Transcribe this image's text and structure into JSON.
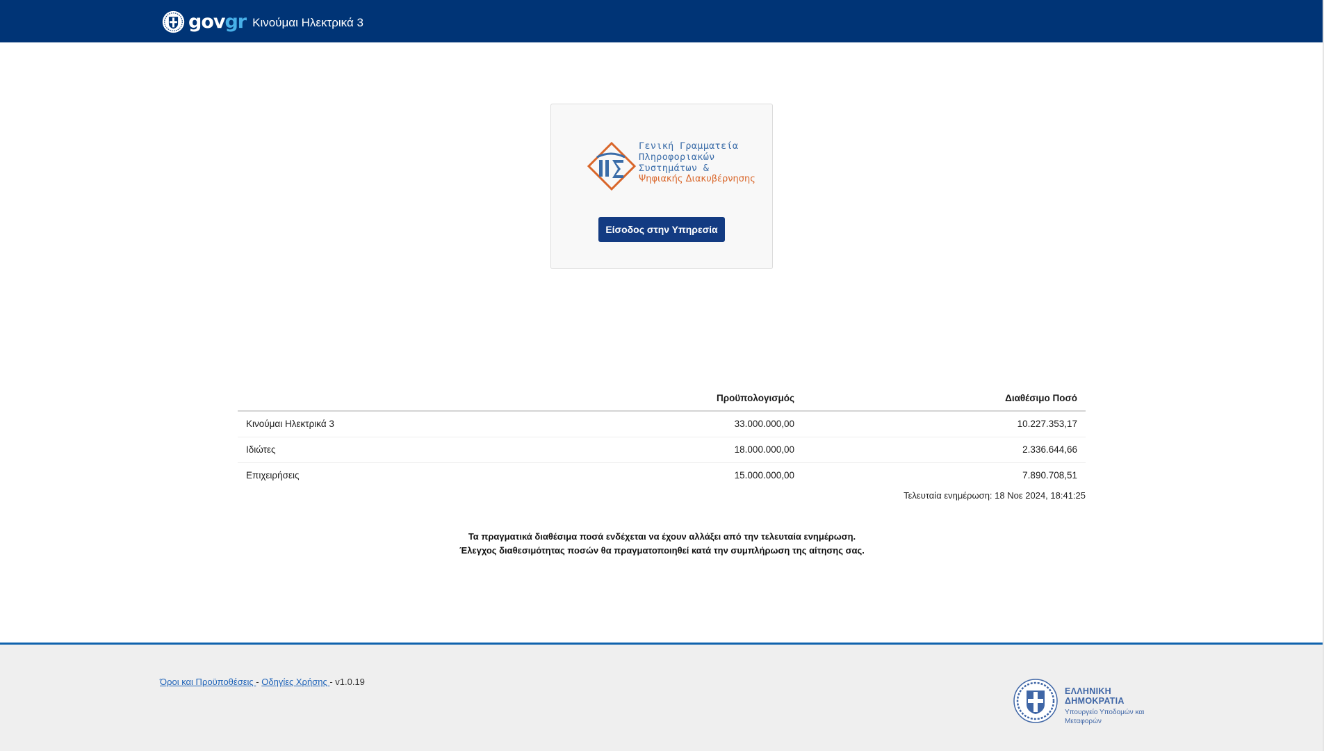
{
  "header": {
    "brand_gov": "gov",
    "brand_gr": "gr",
    "service_title": "Κινούμαι Ηλεκτρικά 3",
    "emblem_icon": "greek-coat-of-arms-icon",
    "background_color": "#003476"
  },
  "card": {
    "logo": {
      "line1": "Γενική Γραμματεία",
      "line2": "Πληροφοριακών",
      "line3": "Συστημάτων &",
      "line4": "Ψηφιακής Διακυβέρνησης"
    },
    "login_label": "Είσοδος στην Υπηρεσία"
  },
  "table": {
    "headers": {
      "budget": "Προϋπολογισμός",
      "available": "Διαθέσιμο Ποσό"
    },
    "rows": [
      {
        "name": "Κινούμαι Ηλεκτρικά 3",
        "budget": "33.000.000,00",
        "available": "10.227.353,17"
      },
      {
        "name": "Ιδιώτες",
        "budget": "18.000.000,00",
        "available": "2.336.644,66"
      },
      {
        "name": "Επιχειρήσεις",
        "budget": "15.000.000,00",
        "available": "7.890.708,51"
      }
    ],
    "last_update": "Τελευταία ενημέρωση: 18 Νοε 2024, 18:41:25"
  },
  "notice": {
    "line1": "Τα πραγματικά διαθέσιμα ποσά ενδέχεται να έχουν αλλάξει από την τελευταία ενημέρωση.",
    "line2": "Έλεγχος διαθεσιμότητας ποσών θα πραγματοποιηθεί κατά την συμπλήρωση της αίτησης σας."
  },
  "footer": {
    "terms_link": "Όροι και Προϋποθέσεις ",
    "separator": " - ",
    "guide_link": "Οδηγίες Χρήσης ",
    "version": " - v1.0.19",
    "ministry": {
      "line1": "ΕΛΛΗΝΙΚΗ ΔΗΜΟΚΡΑΤΙΑ",
      "line2": "Υπουργείο Υποδομών και",
      "line3": "Μεταφορών"
    },
    "accent_color": "#0f62ad"
  }
}
